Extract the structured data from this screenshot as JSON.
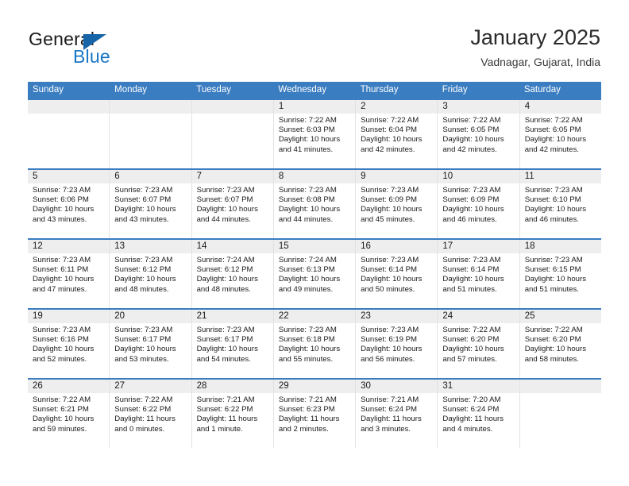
{
  "brand": {
    "name_part1": "General",
    "name_part2": "Blue",
    "triangle_icon": "triangle-icon",
    "accent_color": "#1976c4",
    "header_color": "#3a7dc1"
  },
  "header": {
    "title": "January 2025",
    "subtitle": "Vadnagar, Gujarat, India"
  },
  "calendar": {
    "day_headers": [
      "Sunday",
      "Monday",
      "Tuesday",
      "Wednesday",
      "Thursday",
      "Friday",
      "Saturday"
    ],
    "labels": {
      "sunrise": "Sunrise:",
      "sunset": "Sunset:",
      "daylight": "Daylight:"
    },
    "weeks": [
      [
        {
          "date": "",
          "sunrise": "",
          "sunset": "",
          "daylight_line1": "",
          "daylight_line2": ""
        },
        {
          "date": "",
          "sunrise": "",
          "sunset": "",
          "daylight_line1": "",
          "daylight_line2": ""
        },
        {
          "date": "",
          "sunrise": "",
          "sunset": "",
          "daylight_line1": "",
          "daylight_line2": ""
        },
        {
          "date": "1",
          "sunrise": "Sunrise: 7:22 AM",
          "sunset": "Sunset: 6:03 PM",
          "daylight_line1": "Daylight: 10 hours",
          "daylight_line2": "and 41 minutes."
        },
        {
          "date": "2",
          "sunrise": "Sunrise: 7:22 AM",
          "sunset": "Sunset: 6:04 PM",
          "daylight_line1": "Daylight: 10 hours",
          "daylight_line2": "and 42 minutes."
        },
        {
          "date": "3",
          "sunrise": "Sunrise: 7:22 AM",
          "sunset": "Sunset: 6:05 PM",
          "daylight_line1": "Daylight: 10 hours",
          "daylight_line2": "and 42 minutes."
        },
        {
          "date": "4",
          "sunrise": "Sunrise: 7:22 AM",
          "sunset": "Sunset: 6:05 PM",
          "daylight_line1": "Daylight: 10 hours",
          "daylight_line2": "and 42 minutes."
        }
      ],
      [
        {
          "date": "5",
          "sunrise": "Sunrise: 7:23 AM",
          "sunset": "Sunset: 6:06 PM",
          "daylight_line1": "Daylight: 10 hours",
          "daylight_line2": "and 43 minutes."
        },
        {
          "date": "6",
          "sunrise": "Sunrise: 7:23 AM",
          "sunset": "Sunset: 6:07 PM",
          "daylight_line1": "Daylight: 10 hours",
          "daylight_line2": "and 43 minutes."
        },
        {
          "date": "7",
          "sunrise": "Sunrise: 7:23 AM",
          "sunset": "Sunset: 6:07 PM",
          "daylight_line1": "Daylight: 10 hours",
          "daylight_line2": "and 44 minutes."
        },
        {
          "date": "8",
          "sunrise": "Sunrise: 7:23 AM",
          "sunset": "Sunset: 6:08 PM",
          "daylight_line1": "Daylight: 10 hours",
          "daylight_line2": "and 44 minutes."
        },
        {
          "date": "9",
          "sunrise": "Sunrise: 7:23 AM",
          "sunset": "Sunset: 6:09 PM",
          "daylight_line1": "Daylight: 10 hours",
          "daylight_line2": "and 45 minutes."
        },
        {
          "date": "10",
          "sunrise": "Sunrise: 7:23 AM",
          "sunset": "Sunset: 6:09 PM",
          "daylight_line1": "Daylight: 10 hours",
          "daylight_line2": "and 46 minutes."
        },
        {
          "date": "11",
          "sunrise": "Sunrise: 7:23 AM",
          "sunset": "Sunset: 6:10 PM",
          "daylight_line1": "Daylight: 10 hours",
          "daylight_line2": "and 46 minutes."
        }
      ],
      [
        {
          "date": "12",
          "sunrise": "Sunrise: 7:23 AM",
          "sunset": "Sunset: 6:11 PM",
          "daylight_line1": "Daylight: 10 hours",
          "daylight_line2": "and 47 minutes."
        },
        {
          "date": "13",
          "sunrise": "Sunrise: 7:23 AM",
          "sunset": "Sunset: 6:12 PM",
          "daylight_line1": "Daylight: 10 hours",
          "daylight_line2": "and 48 minutes."
        },
        {
          "date": "14",
          "sunrise": "Sunrise: 7:24 AM",
          "sunset": "Sunset: 6:12 PM",
          "daylight_line1": "Daylight: 10 hours",
          "daylight_line2": "and 48 minutes."
        },
        {
          "date": "15",
          "sunrise": "Sunrise: 7:24 AM",
          "sunset": "Sunset: 6:13 PM",
          "daylight_line1": "Daylight: 10 hours",
          "daylight_line2": "and 49 minutes."
        },
        {
          "date": "16",
          "sunrise": "Sunrise: 7:23 AM",
          "sunset": "Sunset: 6:14 PM",
          "daylight_line1": "Daylight: 10 hours",
          "daylight_line2": "and 50 minutes."
        },
        {
          "date": "17",
          "sunrise": "Sunrise: 7:23 AM",
          "sunset": "Sunset: 6:14 PM",
          "daylight_line1": "Daylight: 10 hours",
          "daylight_line2": "and 51 minutes."
        },
        {
          "date": "18",
          "sunrise": "Sunrise: 7:23 AM",
          "sunset": "Sunset: 6:15 PM",
          "daylight_line1": "Daylight: 10 hours",
          "daylight_line2": "and 51 minutes."
        }
      ],
      [
        {
          "date": "19",
          "sunrise": "Sunrise: 7:23 AM",
          "sunset": "Sunset: 6:16 PM",
          "daylight_line1": "Daylight: 10 hours",
          "daylight_line2": "and 52 minutes."
        },
        {
          "date": "20",
          "sunrise": "Sunrise: 7:23 AM",
          "sunset": "Sunset: 6:17 PM",
          "daylight_line1": "Daylight: 10 hours",
          "daylight_line2": "and 53 minutes."
        },
        {
          "date": "21",
          "sunrise": "Sunrise: 7:23 AM",
          "sunset": "Sunset: 6:17 PM",
          "daylight_line1": "Daylight: 10 hours",
          "daylight_line2": "and 54 minutes."
        },
        {
          "date": "22",
          "sunrise": "Sunrise: 7:23 AM",
          "sunset": "Sunset: 6:18 PM",
          "daylight_line1": "Daylight: 10 hours",
          "daylight_line2": "and 55 minutes."
        },
        {
          "date": "23",
          "sunrise": "Sunrise: 7:23 AM",
          "sunset": "Sunset: 6:19 PM",
          "daylight_line1": "Daylight: 10 hours",
          "daylight_line2": "and 56 minutes."
        },
        {
          "date": "24",
          "sunrise": "Sunrise: 7:22 AM",
          "sunset": "Sunset: 6:20 PM",
          "daylight_line1": "Daylight: 10 hours",
          "daylight_line2": "and 57 minutes."
        },
        {
          "date": "25",
          "sunrise": "Sunrise: 7:22 AM",
          "sunset": "Sunset: 6:20 PM",
          "daylight_line1": "Daylight: 10 hours",
          "daylight_line2": "and 58 minutes."
        }
      ],
      [
        {
          "date": "26",
          "sunrise": "Sunrise: 7:22 AM",
          "sunset": "Sunset: 6:21 PM",
          "daylight_line1": "Daylight: 10 hours",
          "daylight_line2": "and 59 minutes."
        },
        {
          "date": "27",
          "sunrise": "Sunrise: 7:22 AM",
          "sunset": "Sunset: 6:22 PM",
          "daylight_line1": "Daylight: 11 hours",
          "daylight_line2": "and 0 minutes."
        },
        {
          "date": "28",
          "sunrise": "Sunrise: 7:21 AM",
          "sunset": "Sunset: 6:22 PM",
          "daylight_line1": "Daylight: 11 hours",
          "daylight_line2": "and 1 minute."
        },
        {
          "date": "29",
          "sunrise": "Sunrise: 7:21 AM",
          "sunset": "Sunset: 6:23 PM",
          "daylight_line1": "Daylight: 11 hours",
          "daylight_line2": "and 2 minutes."
        },
        {
          "date": "30",
          "sunrise": "Sunrise: 7:21 AM",
          "sunset": "Sunset: 6:24 PM",
          "daylight_line1": "Daylight: 11 hours",
          "daylight_line2": "and 3 minutes."
        },
        {
          "date": "31",
          "sunrise": "Sunrise: 7:20 AM",
          "sunset": "Sunset: 6:24 PM",
          "daylight_line1": "Daylight: 11 hours",
          "daylight_line2": "and 4 minutes."
        },
        {
          "date": "",
          "sunrise": "",
          "sunset": "",
          "daylight_line1": "",
          "daylight_line2": ""
        }
      ]
    ]
  }
}
